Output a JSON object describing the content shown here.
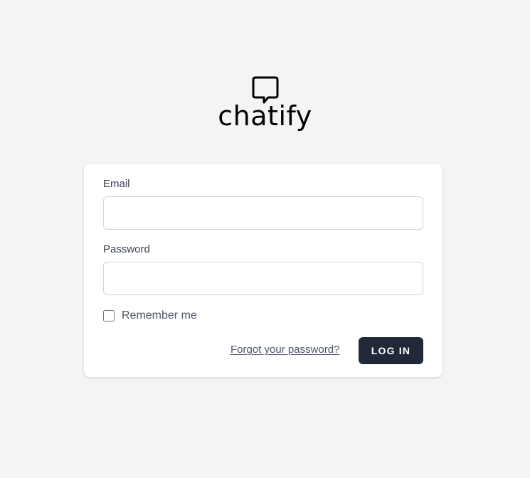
{
  "logo": {
    "icon": "chat-bubble-icon",
    "text": "chatify"
  },
  "form": {
    "email_label": "Email",
    "email_value": "",
    "password_label": "Password",
    "password_value": "",
    "remember_label": "Remember me",
    "remember_checked": false,
    "forgot_link": "Forgot your password?",
    "login_button": "LOG IN"
  },
  "colors": {
    "background": "#f3f4f6",
    "card": "#ffffff",
    "button": "#1f2937",
    "button_text": "#ffffff",
    "label_text": "#374151",
    "link_text": "#4b5563"
  }
}
